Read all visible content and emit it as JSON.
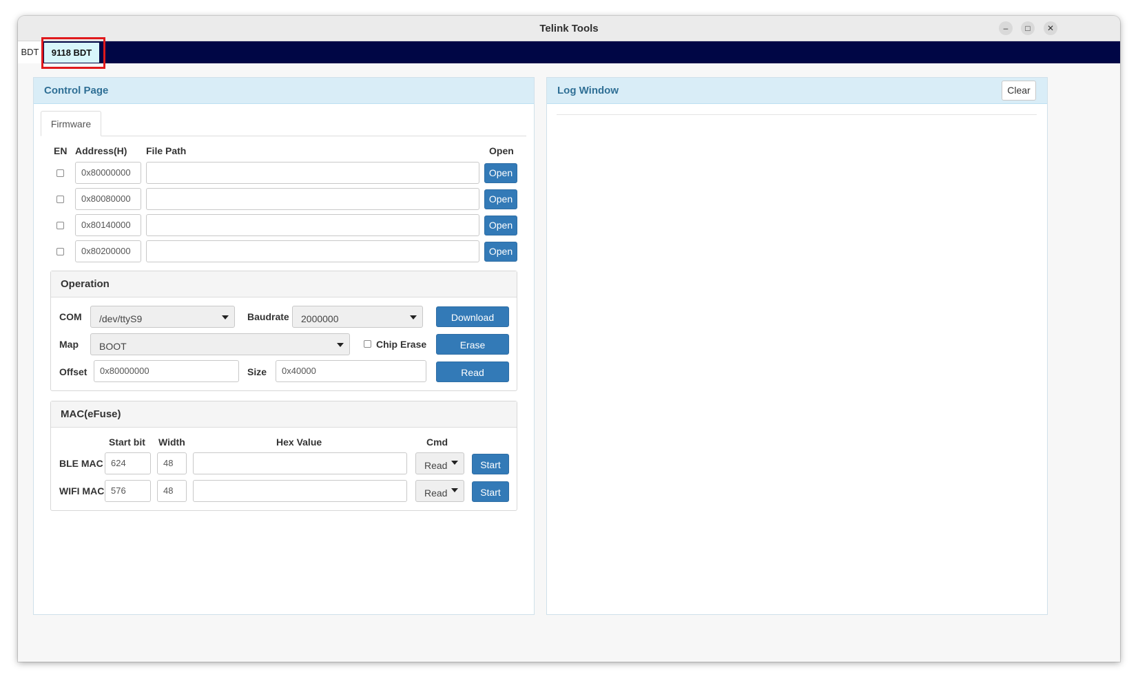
{
  "window": {
    "title": "Telink Tools",
    "controls": {
      "minimize": "–",
      "maximize": "□",
      "close": "✕"
    }
  },
  "tabs": [
    {
      "label": "BDT"
    },
    {
      "label": "9118 BDT"
    }
  ],
  "control_page": {
    "title": "Control Page",
    "inner_tab": "Firmware",
    "headers": {
      "en": "EN",
      "address": "Address(H)",
      "file_path": "File Path",
      "open": "Open"
    },
    "rows": [
      {
        "address": "0x80000000",
        "file_path": "",
        "open_label": "Open"
      },
      {
        "address": "0x80080000",
        "file_path": "",
        "open_label": "Open"
      },
      {
        "address": "0x80140000",
        "file_path": "",
        "open_label": "Open"
      },
      {
        "address": "0x80200000",
        "file_path": "",
        "open_label": "Open"
      }
    ],
    "operation": {
      "title": "Operation",
      "com_label": "COM",
      "com_value": "/dev/ttyS9",
      "baudrate_label": "Baudrate",
      "baudrate_value": "2000000",
      "map_label": "Map",
      "map_value": "BOOT",
      "chip_erase_label": "Chip Erase",
      "offset_label": "Offset",
      "offset_value": "0x80000000",
      "size_label": "Size",
      "size_value": "0x40000",
      "download_label": "Download",
      "erase_label": "Erase",
      "read_label": "Read"
    },
    "mac": {
      "title": "MAC(eFuse)",
      "headers": {
        "start_bit": "Start bit",
        "width": "Width",
        "hex_value": "Hex Value",
        "cmd": "Cmd"
      },
      "rows": [
        {
          "label": "BLE MAC",
          "start_bit": "624",
          "width": "48",
          "hex_value": "",
          "cmd": "Read",
          "action": "Start"
        },
        {
          "label": "WIFI MAC",
          "start_bit": "576",
          "width": "48",
          "hex_value": "",
          "cmd": "Read",
          "action": "Start"
        }
      ]
    }
  },
  "log_window": {
    "title": "Log Window",
    "clear_label": "Clear"
  },
  "colors": {
    "tab_strip": "#000645",
    "active_tab": "#d8f6fb",
    "highlight": "#e0191c",
    "panel_header": "#d9edf7",
    "primary_button": "#337ab7"
  }
}
